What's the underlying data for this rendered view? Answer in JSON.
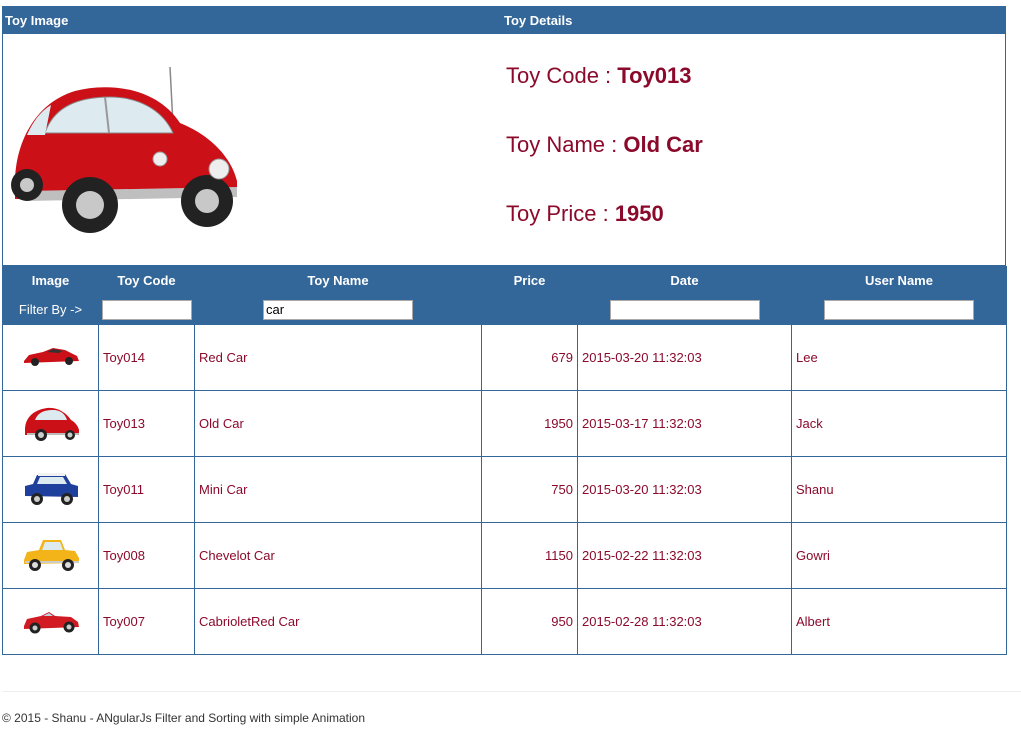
{
  "details_panel": {
    "header_image": "Toy Image",
    "header_details": "Toy Details",
    "image_icon": "red-beetle-car-icon",
    "code_label": "Toy Code : ",
    "code_value": "Toy013",
    "name_label": "Toy Name : ",
    "name_value": "Old Car",
    "price_label": "Toy Price : ",
    "price_value": "1950"
  },
  "grid": {
    "columns": [
      "Image",
      "Toy Code",
      "Toy Name",
      "Price",
      "Date",
      "User Name"
    ],
    "filter_label": "Filter By ->",
    "filters": {
      "code": "",
      "name": "car",
      "date": "",
      "user": ""
    },
    "rows": [
      {
        "image": "red-sports-car-icon",
        "code": "Toy014",
        "name": "Red Car",
        "price": "679",
        "date": "2015-03-20 11:32:03",
        "user": "Lee"
      },
      {
        "image": "red-beetle-car-icon",
        "code": "Toy013",
        "name": "Old Car",
        "price": "1950",
        "date": "2015-03-17 11:32:03",
        "user": "Jack"
      },
      {
        "image": "blue-mini-car-icon",
        "code": "Toy011",
        "name": "Mini Car",
        "price": "750",
        "date": "2015-03-20 11:32:03",
        "user": "Shanu"
      },
      {
        "image": "yellow-vintage-car-icon",
        "code": "Toy008",
        "name": "Chevelot Car",
        "price": "1150",
        "date": "2015-02-22 11:32:03",
        "user": "Gowri"
      },
      {
        "image": "red-convertible-car-icon",
        "code": "Toy007",
        "name": "CabrioletRed Car",
        "price": "950",
        "date": "2015-02-28 11:32:03",
        "user": "Albert"
      }
    ]
  },
  "colors": {
    "header_bg": "#336699",
    "text_accent": "#8b0a2b"
  },
  "footer": {
    "text": "© 2015 - Shanu - ANgularJs Filter and Sorting with simple Animation"
  }
}
